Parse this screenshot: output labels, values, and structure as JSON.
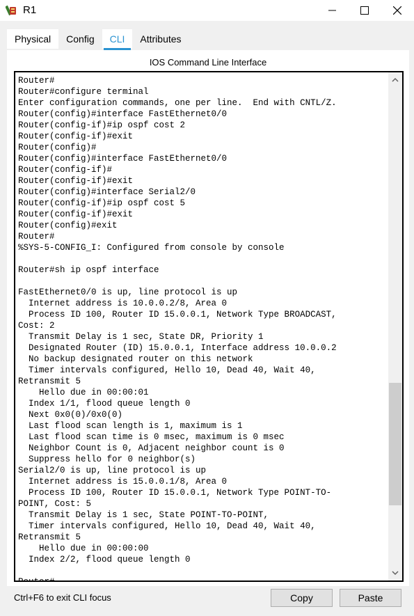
{
  "window": {
    "title": "R1",
    "icon": "router-app-icon",
    "controls": [
      "minimize-icon",
      "maximize-icon",
      "close-icon"
    ]
  },
  "tabs": [
    {
      "label": "Physical",
      "active": false
    },
    {
      "label": "Config",
      "active": false
    },
    {
      "label": "CLI",
      "active": true
    },
    {
      "label": "Attributes",
      "active": false
    }
  ],
  "panel": {
    "heading": "IOS Command Line Interface"
  },
  "console": {
    "lines": [
      "Router#",
      "Router#configure terminal",
      "Enter configuration commands, one per line.  End with CNTL/Z.",
      "Router(config)#interface FastEthernet0/0",
      "Router(config-if)#ip ospf cost 2",
      "Router(config-if)#exit",
      "Router(config)#",
      "Router(config)#interface FastEthernet0/0",
      "Router(config-if)#",
      "Router(config-if)#exit",
      "Router(config)#interface Serial2/0",
      "Router(config-if)#ip ospf cost 5",
      "Router(config-if)#exit",
      "Router(config)#exit",
      "Router#",
      "%SYS-5-CONFIG_I: Configured from console by console",
      "",
      "Router#sh ip ospf interface",
      "",
      "FastEthernet0/0 is up, line protocol is up",
      "  Internet address is 10.0.0.2/8, Area 0",
      "  Process ID 100, Router ID 15.0.0.1, Network Type BROADCAST,",
      "Cost: 2",
      "  Transmit Delay is 1 sec, State DR, Priority 1",
      "  Designated Router (ID) 15.0.0.1, Interface address 10.0.0.2",
      "  No backup designated router on this network",
      "  Timer intervals configured, Hello 10, Dead 40, Wait 40,",
      "Retransmit 5",
      "    Hello due in 00:00:01",
      "  Index 1/1, flood queue length 0",
      "  Next 0x0(0)/0x0(0)",
      "  Last flood scan length is 1, maximum is 1",
      "  Last flood scan time is 0 msec, maximum is 0 msec",
      "  Neighbor Count is 0, Adjacent neighbor count is 0",
      "  Suppress hello for 0 neighbor(s)",
      "Serial2/0 is up, line protocol is up",
      "  Internet address is 15.0.0.1/8, Area 0",
      "  Process ID 100, Router ID 15.0.0.1, Network Type POINT-TO-",
      "POINT, Cost: 5",
      "  Transmit Delay is 1 sec, State POINT-TO-POINT,",
      "  Timer intervals configured, Hello 10, Dead 40, Wait 40,",
      "Retransmit 5",
      "    Hello due in 00:00:00",
      "  Index 2/2, flood queue length 0",
      "",
      "Router#"
    ]
  },
  "footer": {
    "hint": "Ctrl+F6 to exit CLI focus",
    "copy_label": "Copy",
    "paste_label": "Paste"
  },
  "colors": {
    "accent": "#2b93d1",
    "background": "#f0f0f0",
    "button_face": "#e1e1e1"
  }
}
